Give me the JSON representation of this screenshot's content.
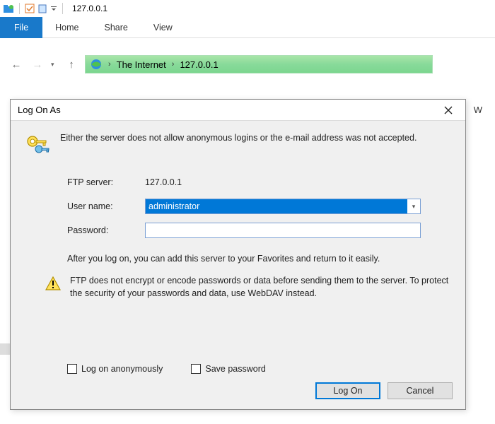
{
  "titlebar": {
    "title": "127.0.0.1"
  },
  "ribbon": {
    "file": "File",
    "home": "Home",
    "share": "Share",
    "view": "View"
  },
  "nav": {
    "breadcrumb": {
      "root": "The Internet",
      "leaf": "127.0.0.1"
    }
  },
  "side_letter": "W",
  "dialog": {
    "title": "Log On As",
    "message": "Either the server does not allow anonymous logins or the e-mail address was not accepted.",
    "ftp_server_label": "FTP server:",
    "ftp_server_value": "127.0.0.1",
    "username_label": "User name:",
    "username_value": "administrator",
    "password_label": "Password:",
    "password_value": "",
    "hint": "After you log on, you can add this server to your Favorites and return to it easily.",
    "warning": "FTP does not encrypt or encode passwords or data before sending them to the server.  To protect the security of your passwords and data, use WebDAV instead.",
    "logon_anon_label": "Log on anonymously",
    "save_password_label": "Save password",
    "logon_button": "Log On",
    "cancel_button": "Cancel"
  }
}
